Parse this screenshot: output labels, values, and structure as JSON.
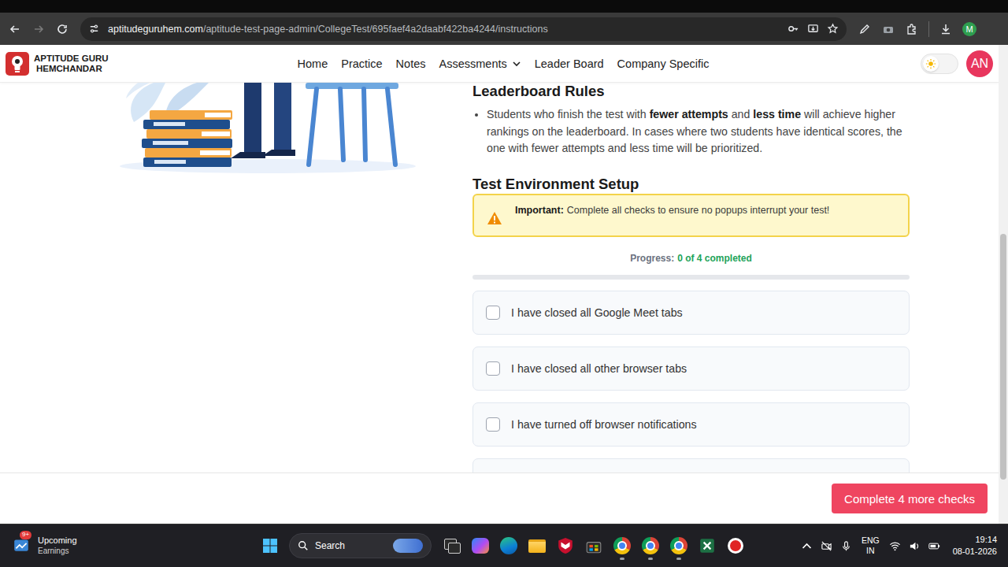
{
  "browser": {
    "url_host": "aptitudeguruhem.com",
    "url_path": "/aptitude-test-page-admin/CollegeTest/695faef4a2daabf422ba4244/instructions",
    "profile": "M"
  },
  "site": {
    "logo_line1": "APTITUDE GURU",
    "logo_line2": "HEMCHANDAR",
    "nav": [
      {
        "label": "Home",
        "dropdown": false
      },
      {
        "label": "Practice",
        "dropdown": false
      },
      {
        "label": "Notes",
        "dropdown": false
      },
      {
        "label": "Assessments",
        "dropdown": true
      },
      {
        "label": "Leader Board",
        "dropdown": false
      },
      {
        "label": "Company Specific",
        "dropdown": false
      }
    ],
    "dark_mode": false,
    "avatar": "AN"
  },
  "leaderboard": {
    "title": "Leaderboard Rules",
    "rule": [
      {
        "text": "Students who finish the test with ",
        "bold": false
      },
      {
        "text": "fewer attempts",
        "bold": true
      },
      {
        "text": " and ",
        "bold": false
      },
      {
        "text": "less time",
        "bold": true
      },
      {
        "text": " will achieve higher rankings on the leaderboard. In cases where two students have identical scores, the one with fewer attempts and less time will be prioritized.",
        "bold": false
      }
    ]
  },
  "setup": {
    "title": "Test Environment Setup",
    "warning_label": "Important:",
    "warning_text": "Complete all checks to ensure no popups interrupt your test!",
    "progress_label": "Progress:",
    "progress_value": "0 of 4 completed",
    "level": 0,
    "checks": [
      {
        "label": "I have closed all Google Meet tabs",
        "checked": false
      },
      {
        "label": "I have closed all other browser tabs",
        "checked": false
      },
      {
        "label": "I have turned off browser notifications",
        "checked": false
      },
      {
        "checked": false
      }
    ]
  },
  "footer": {
    "button": "Complete 4 more checks"
  },
  "taskbar": {
    "widget_title": "Upcoming",
    "widget_sub": "Earnings",
    "widget_badge": "9+",
    "search": "Search",
    "lang": "ENG",
    "region": "IN",
    "time": "19:14",
    "date": "08-01-2026"
  }
}
